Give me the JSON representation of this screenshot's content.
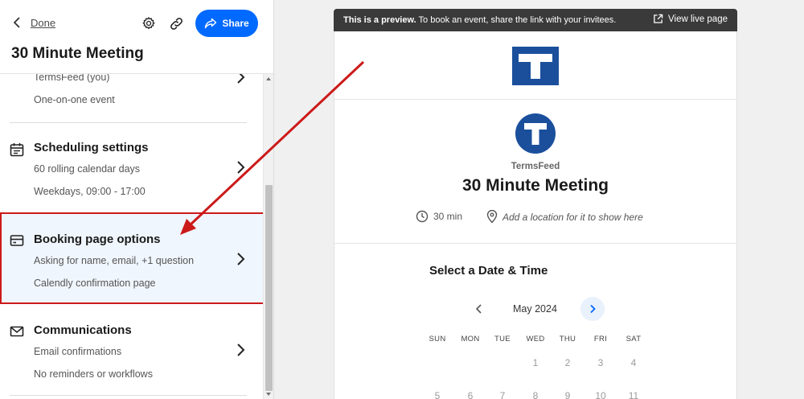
{
  "header": {
    "back_label": "Done",
    "share_label": "Share",
    "page_title": "30 Minute Meeting"
  },
  "sections": {
    "event": {
      "line1": "TermsFeed (you)",
      "line2": "One-on-one event"
    },
    "scheduling": {
      "title": "Scheduling settings",
      "line1": "60 rolling calendar days",
      "line2": "Weekdays, 09:00 - 17:00"
    },
    "booking": {
      "title": "Booking page options",
      "line1": "Asking for name, email, +1 question",
      "line2": "Calendly confirmation page"
    },
    "communications": {
      "title": "Communications",
      "line1": "Email confirmations",
      "line2": "No reminders or workflows"
    }
  },
  "preview": {
    "notice_bold": "This is a preview.",
    "notice_text": " To book an event, share the link with your invitees.",
    "view_live": "View live page",
    "organization": "TermsFeed",
    "event_title": "30 Minute Meeting",
    "duration": "30 min",
    "location": "Add a location for it to show here",
    "select_title": "Select a Date & Time",
    "month": "May 2024",
    "weekdays": [
      "SUN",
      "MON",
      "TUE",
      "WED",
      "THU",
      "FRI",
      "SAT"
    ],
    "week1": [
      "",
      "",
      "",
      "1",
      "2",
      "3",
      "4"
    ],
    "week2": [
      "5",
      "6",
      "7",
      "8",
      "9",
      "10",
      "11"
    ]
  },
  "colors": {
    "accent": "#0069ff",
    "highlight_border": "#cc1a1a",
    "brand_logo": "#1b4f9c"
  }
}
